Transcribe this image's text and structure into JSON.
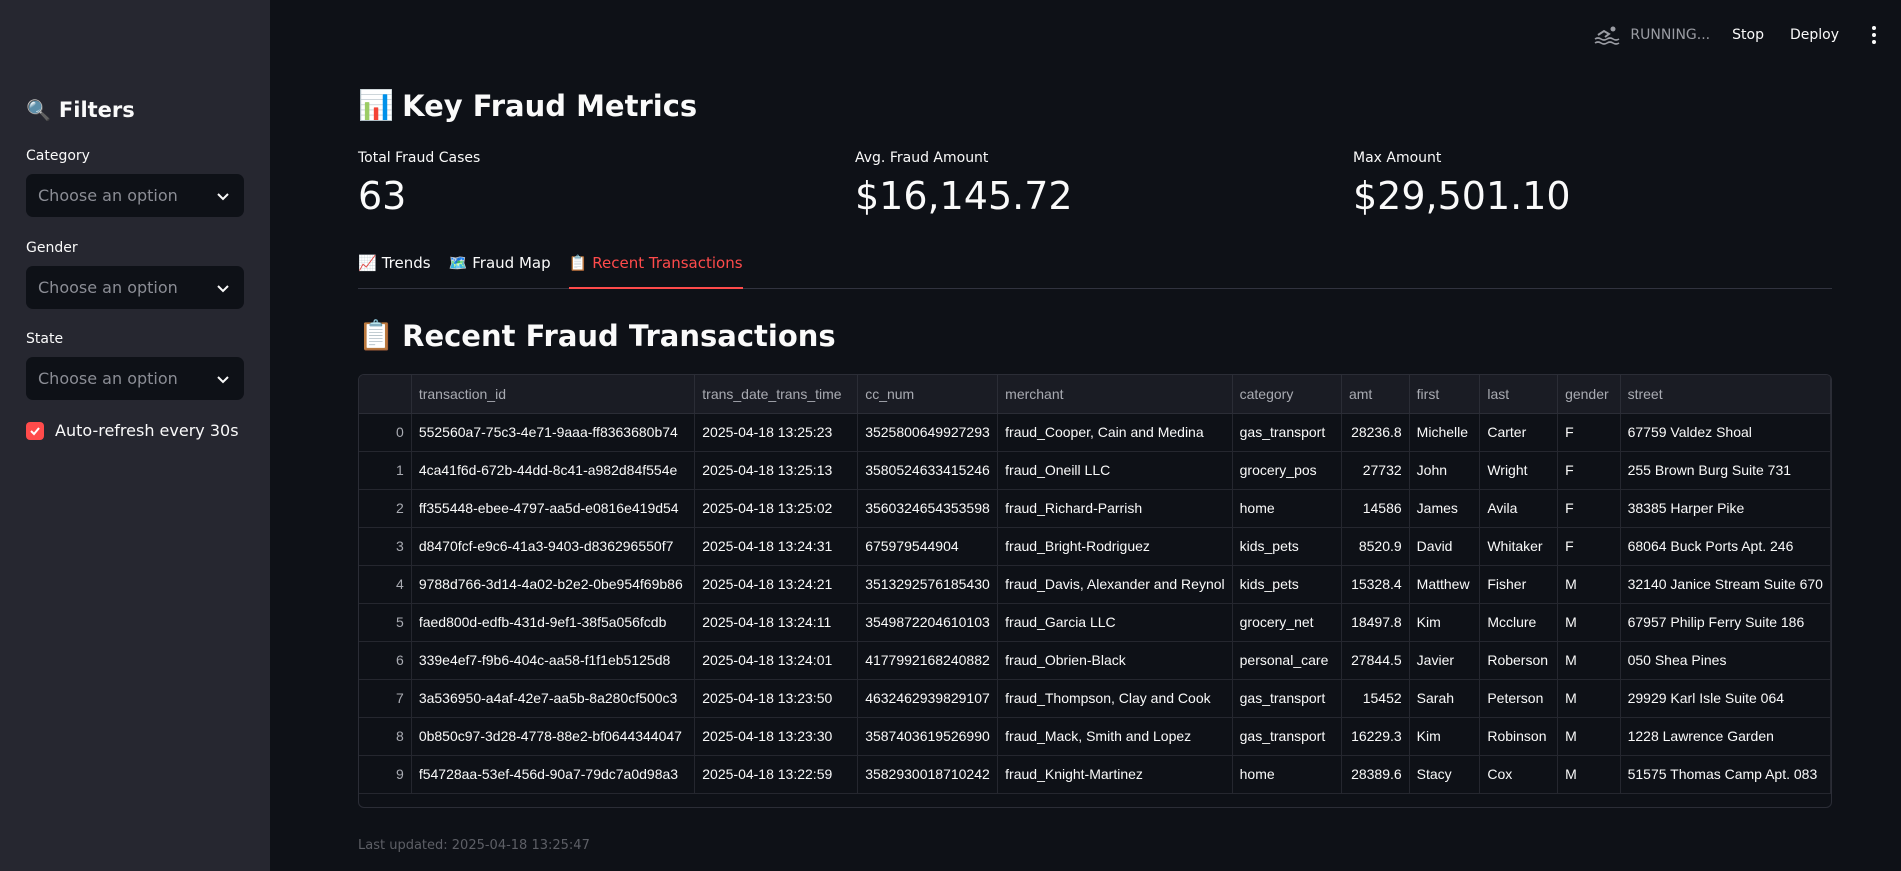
{
  "sidebar": {
    "title": "Filters",
    "title_icon": "🔍",
    "filters": [
      {
        "label": "Category",
        "placeholder": "Choose an option"
      },
      {
        "label": "Gender",
        "placeholder": "Choose an option"
      },
      {
        "label": "State",
        "placeholder": "Choose an option"
      }
    ],
    "auto_refresh": {
      "label": "Auto-refresh every 30s",
      "checked": true
    }
  },
  "header": {
    "status": "RUNNING...",
    "stop_label": "Stop",
    "deploy_label": "Deploy"
  },
  "main": {
    "metrics_title": "Key Fraud Metrics",
    "metrics_icon": "📊",
    "metrics": [
      {
        "label": "Total Fraud Cases",
        "value": "63"
      },
      {
        "label": "Avg. Fraud Amount",
        "value": "$16,145.72"
      },
      {
        "label": "Max Amount",
        "value": "$29,501.10"
      }
    ],
    "tabs": [
      {
        "icon": "📈",
        "label": "Trends",
        "active": false
      },
      {
        "icon": "🗺️",
        "label": "Fraud Map",
        "active": false
      },
      {
        "icon": "📋",
        "label": "Recent Transactions",
        "active": true
      }
    ],
    "section_title": "Recent Fraud Transactions",
    "section_icon": "📋",
    "table": {
      "columns": [
        "",
        "transaction_id",
        "trans_date_trans_time",
        "cc_num",
        "merchant",
        "category",
        "amt",
        "first",
        "last",
        "gender",
        "street"
      ],
      "rows": [
        [
          "0",
          "552560a7-75c3-4e71-9aaa-ff8363680b74",
          "2025-04-18 13:25:23",
          "3525800649927293",
          "fraud_Cooper, Cain and Medina",
          "gas_transport",
          "28236.8",
          "Michelle",
          "Carter",
          "F",
          "67759 Valdez Shoal"
        ],
        [
          "1",
          "4ca41f6d-672b-44dd-8c41-a982d84f554e",
          "2025-04-18 13:25:13",
          "3580524633415246",
          "fraud_Oneill LLC",
          "grocery_pos",
          "27732",
          "John",
          "Wright",
          "F",
          "255 Brown Burg Suite 731"
        ],
        [
          "2",
          "ff355448-ebee-4797-aa5d-e0816e419d54",
          "2025-04-18 13:25:02",
          "3560324654353598",
          "fraud_Richard-Parrish",
          "home",
          "14586",
          "James",
          "Avila",
          "F",
          "38385 Harper Pike"
        ],
        [
          "3",
          "d8470fcf-e9c6-41a3-9403-d836296550f7",
          "2025-04-18 13:24:31",
          "675979544904",
          "fraud_Bright-Rodriguez",
          "kids_pets",
          "8520.9",
          "David",
          "Whitaker",
          "F",
          "68064 Buck Ports Apt. 246"
        ],
        [
          "4",
          "9788d766-3d14-4a02-b2e2-0be954f69b86",
          "2025-04-18 13:24:21",
          "3513292576185430",
          "fraud_Davis, Alexander and Reynol",
          "kids_pets",
          "15328.4",
          "Matthew",
          "Fisher",
          "M",
          "32140 Janice Stream Suite 670"
        ],
        [
          "5",
          "faed800d-edfb-431d-9ef1-38f5a056fcdb",
          "2025-04-18 13:24:11",
          "3549872204610103",
          "fraud_Garcia LLC",
          "grocery_net",
          "18497.8",
          "Kim",
          "Mcclure",
          "M",
          "67957 Philip Ferry Suite 186"
        ],
        [
          "6",
          "339e4ef7-f9b6-404c-aa58-f1f1eb5125d8",
          "2025-04-18 13:24:01",
          "4177992168240882",
          "fraud_Obrien-Black",
          "personal_care",
          "27844.5",
          "Javier",
          "Roberson",
          "M",
          "050 Shea Pines"
        ],
        [
          "7",
          "3a536950-a4af-42e7-aa5b-8a280cf500c3",
          "2025-04-18 13:23:50",
          "4632462939829107",
          "fraud_Thompson, Clay and Cook",
          "gas_transport",
          "15452",
          "Sarah",
          "Peterson",
          "M",
          "29929 Karl Isle Suite 064"
        ],
        [
          "8",
          "0b850c97-3d28-4778-88e2-bf0644344047",
          "2025-04-18 13:23:30",
          "3587403619526990",
          "fraud_Mack, Smith and Lopez",
          "gas_transport",
          "16229.3",
          "Kim",
          "Robinson",
          "M",
          "1228 Lawrence Garden"
        ],
        [
          "9",
          "f54728aa-53ef-456d-90a7-79dc7a0d98a3",
          "2025-04-18 13:22:59",
          "3582930018710242",
          "fraud_Knight-Martinez",
          "home",
          "28389.6",
          "Stacy",
          "Cox",
          "M",
          "51575 Thomas Camp Apt. 083"
        ]
      ]
    },
    "footer": "Last updated: 2025-04-18 13:25:47"
  }
}
